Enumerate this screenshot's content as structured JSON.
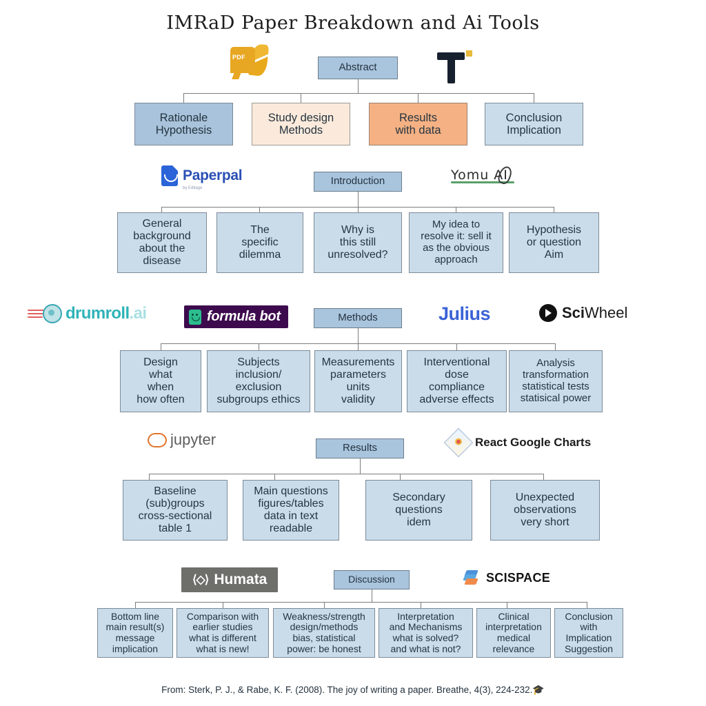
{
  "title": "IMRaD Paper Breakdown and Ai Tools",
  "sections": [
    {
      "header": "Abstract",
      "logos": [
        {
          "name": "pdf-logo",
          "label": "PDF"
        },
        {
          "name": "typeset-t-logo",
          "label": "T"
        }
      ],
      "boxes": [
        {
          "lines": [
            "Rationale",
            "Hypothesis"
          ],
          "color": "#a8c3db",
          "style": "blue"
        },
        {
          "lines": [
            "Study design",
            "Methods"
          ],
          "color": "#fbeadb",
          "style": "cream"
        },
        {
          "lines": [
            "Results",
            "with data"
          ],
          "color": "#f5b183",
          "style": "orange"
        },
        {
          "lines": [
            "Conclusion",
            "Implication"
          ],
          "color": "#cadcea",
          "style": "lightblue"
        }
      ]
    },
    {
      "header": "Introduction",
      "logos": [
        {
          "name": "paperpal-logo",
          "label": "Paperpal",
          "sub": "by Editage"
        },
        {
          "name": "yomu-ai-logo",
          "label": "Yomu AI"
        }
      ],
      "boxes": [
        {
          "lines": [
            "General",
            "background",
            "about the",
            "disease"
          ]
        },
        {
          "lines": [
            "The",
            "specific",
            "dilemma"
          ]
        },
        {
          "lines": [
            "Why is",
            "this still",
            "unresolved?"
          ]
        },
        {
          "lines": [
            "My idea to",
            "resolve it: sell it",
            "as the obvious",
            "approach"
          ]
        },
        {
          "lines": [
            "Hypothesis",
            "or question",
            "Aim"
          ]
        }
      ]
    },
    {
      "header": "Methods",
      "logos": [
        {
          "name": "drumroll-ai-logo",
          "label": "drumroll",
          "suffix": ".ai"
        },
        {
          "name": "formula-bot-logo",
          "label": "formula bot"
        },
        {
          "name": "julius-logo",
          "label": "Julius"
        },
        {
          "name": "sciwheel-logo",
          "label": "Sci",
          "suffix": "Wheel"
        }
      ],
      "boxes": [
        {
          "lines": [
            "Design",
            "what",
            "when",
            "how often"
          ]
        },
        {
          "lines": [
            "Subjects",
            "inclusion/",
            "exclusion",
            "subgroups ethics"
          ]
        },
        {
          "lines": [
            "Measurements",
            "parameters",
            "units",
            "validity"
          ]
        },
        {
          "lines": [
            "Interventional",
            "dose",
            "compliance",
            "adverse effects"
          ]
        },
        {
          "lines": [
            "Analysis",
            "transformation",
            "statistical tests",
            "statisical power"
          ]
        }
      ]
    },
    {
      "header": "Results",
      "logos": [
        {
          "name": "jupyter-logo",
          "label": "jupyter"
        },
        {
          "name": "react-google-charts-logo",
          "label": "React Google Charts"
        }
      ],
      "boxes": [
        {
          "lines": [
            "Baseline",
            "(sub)groups",
            "cross-sectional",
            "table 1"
          ]
        },
        {
          "lines": [
            "Main questions",
            "figures/tables",
            "data in text",
            "readable"
          ]
        },
        {
          "lines": [
            "Secondary",
            "questions",
            "idem"
          ]
        },
        {
          "lines": [
            "Unexpected",
            "observations",
            "very short"
          ]
        }
      ]
    },
    {
      "header": "Discussion",
      "logos": [
        {
          "name": "humata-logo",
          "label": "Humata"
        },
        {
          "name": "scispace-logo",
          "label": "SCISPACE"
        }
      ],
      "boxes": [
        {
          "lines": [
            "Bottom line",
            "main result(s)",
            "message",
            "implication"
          ]
        },
        {
          "lines": [
            "Comparison with",
            "earlier studies",
            "what is different",
            "what is new!"
          ]
        },
        {
          "lines": [
            "Weakness/strength",
            "design/methods",
            "bias, statistical",
            "power: be honest"
          ]
        },
        {
          "lines": [
            "Interpretation",
            "and Mechanisms",
            "what is solved?",
            "and what is not?"
          ]
        },
        {
          "lines": [
            "Clinical",
            "interpretation",
            "medical",
            "relevance"
          ]
        },
        {
          "lines": [
            "Conclusion",
            "with",
            "Implication",
            "Suggestion"
          ]
        }
      ]
    }
  ],
  "footer": "From: Sterk, P. J., & Rabe, K. F. (2008). The joy of writing a paper. Breathe, 4(3), 224-232.",
  "footer_icon": "🎓",
  "colors": {
    "header_blue": "#a9c4dd",
    "box_blue": "#a8c3db",
    "box_light_blue": "#cadcea",
    "box_cream": "#fbeadb",
    "box_orange": "#f5b183",
    "line": "#7c7c7c"
  }
}
